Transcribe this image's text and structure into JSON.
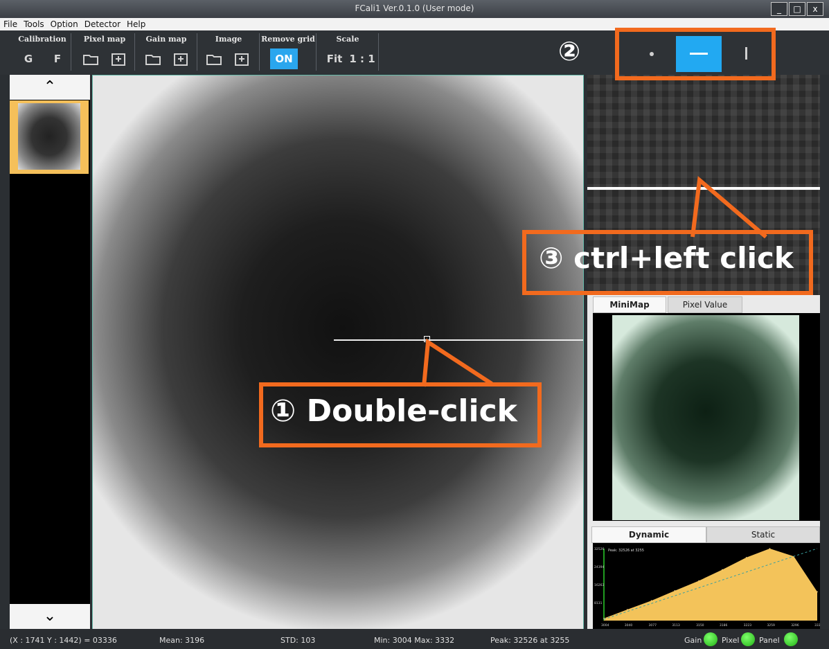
{
  "window": {
    "title": "FCali1 Ver.0.1.0 (User mode)",
    "buttons": [
      "_",
      "□",
      "x"
    ]
  },
  "menu": [
    "File",
    "Tools",
    "Option",
    "Detector",
    "Help"
  ],
  "toolbar": {
    "calibration": {
      "label": "Calibration",
      "g": "G",
      "f": "F"
    },
    "pixel_map": {
      "label": "Pixel map"
    },
    "gain_map": {
      "label": "Gain map"
    },
    "image": {
      "label": "Image"
    },
    "remove_grid": {
      "label": "Remove grid",
      "value": "ON"
    },
    "scale": {
      "label": "Scale",
      "fit": "Fit",
      "one_to_one": "1 : 1"
    }
  },
  "profile_modes": {
    "selected": "horizontal",
    "items": [
      "point",
      "horizontal",
      "vertical"
    ]
  },
  "right_tabs": {
    "minimap": "MiniMap",
    "pixel_value": "Pixel Value"
  },
  "graph_tabs": {
    "dynamic": "Dynamic",
    "static": "Static"
  },
  "chart": {
    "peak_label": "Peak: 32526 at 3255",
    "y_ticks": [
      "32526",
      "24394",
      "16263",
      "8131"
    ],
    "x_ticks": [
      "3004",
      "3040",
      "3077",
      "3113",
      "3150",
      "3186",
      "3223",
      "3259",
      "3296",
      "3332"
    ]
  },
  "chart_data": {
    "type": "area",
    "x": [
      3004,
      3040,
      3077,
      3113,
      3150,
      3186,
      3223,
      3259,
      3296,
      3332
    ],
    "values": [
      1000,
      5000,
      9000,
      13500,
      18000,
      23000,
      28500,
      32526,
      29000,
      13000
    ],
    "ylim": [
      0,
      32526
    ],
    "title": "Peak: 32526 at 3255",
    "colors": {
      "fill": "#f3c35a",
      "trend": "#3aa0a0"
    }
  },
  "status": {
    "coords": "(X : 1741 Y : 1442) = 03336",
    "mean": "Mean: 3196",
    "std": "STD: 103",
    "minmax": "Min: 3004 Max: 3332",
    "peak": "Peak: 32526 at 3255",
    "gain": "Gain",
    "pixel": "Pixel",
    "panel": "Panel"
  },
  "callouts": {
    "one": "① Double-click",
    "two": "②",
    "three": "③ ctrl+left click"
  },
  "colors": {
    "accent": "#22a9f2",
    "callout": "#f26a1e",
    "led": "#3fd52a"
  }
}
